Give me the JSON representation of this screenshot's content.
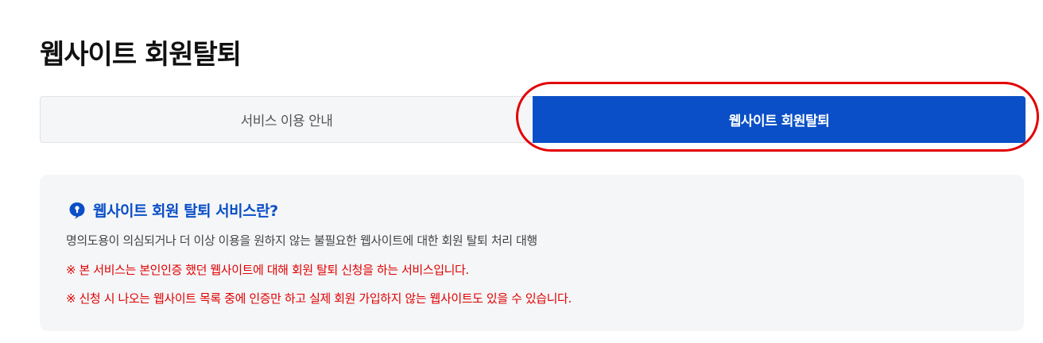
{
  "page": {
    "title": "웹사이트 회원탈퇴"
  },
  "tabs": [
    {
      "label": "서비스 이용 안내",
      "active": false
    },
    {
      "label": "웹사이트 회원탈퇴",
      "active": true
    }
  ],
  "info": {
    "heading": "웹사이트 회원 탈퇴 서비스란?",
    "description": "명의도용이 의심되거나 더 이상 이용을 원하지 않는 불필요한 웹사이트에 대한 회원 탈퇴 처리 대행",
    "notes": [
      "※ 본 서비스는 본인인증 했던 웹사이트에 대해 회원 탈퇴 신청을 하는 서비스입니다.",
      "※ 신청 시 나오는 웹사이트 목록 중에 인증만 하고 실제 회원 가입하지 않는 웹사이트도 있을 수 있습니다."
    ],
    "icon": "keyhole-speech-bubble-icon"
  },
  "colors": {
    "accent": "#0a4fc7",
    "highlight": "#e30000",
    "warning_text": "#e00000",
    "panel_bg": "#f5f6f8"
  }
}
